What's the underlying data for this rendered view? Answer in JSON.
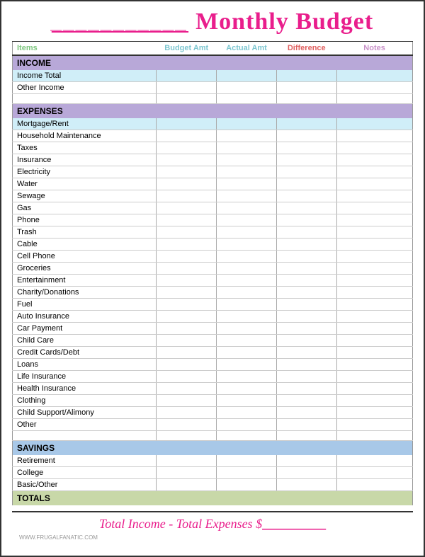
{
  "header": {
    "underline_text": "___________",
    "title": "Monthly Budget"
  },
  "columns": {
    "items": "Items",
    "budget": "Budget Amt",
    "actual": "Actual Amt",
    "difference": "Difference",
    "notes": "Notes"
  },
  "sections": {
    "income": {
      "label": "INCOME",
      "rows": [
        {
          "label": "Income Total"
        },
        {
          "label": "Other Income"
        },
        {
          "label": ""
        }
      ]
    },
    "expenses": {
      "label": "EXPENSES",
      "rows": [
        {
          "label": "Mortgage/Rent"
        },
        {
          "label": "Household Maintenance"
        },
        {
          "label": "Taxes"
        },
        {
          "label": "Insurance"
        },
        {
          "label": "Electricity"
        },
        {
          "label": "Water"
        },
        {
          "label": "Sewage"
        },
        {
          "label": "Gas"
        },
        {
          "label": "Phone"
        },
        {
          "label": "Trash"
        },
        {
          "label": "Cable"
        },
        {
          "label": "Cell Phone"
        },
        {
          "label": "Groceries"
        },
        {
          "label": "Entertainment"
        },
        {
          "label": "Charity/Donations"
        },
        {
          "label": "Fuel"
        },
        {
          "label": "Auto Insurance"
        },
        {
          "label": "Car Payment"
        },
        {
          "label": "Child Care"
        },
        {
          "label": "Credit Cards/Debt"
        },
        {
          "label": "Loans"
        },
        {
          "label": "Life Insurance"
        },
        {
          "label": "Health Insurance"
        },
        {
          "label": "Clothing"
        },
        {
          "label": "Child Support/Alimony"
        },
        {
          "label": "Other"
        },
        {
          "label": ""
        }
      ]
    },
    "savings": {
      "label": "SAVINGS",
      "rows": [
        {
          "label": "Retirement"
        },
        {
          "label": "College"
        },
        {
          "label": "Basic/Other"
        }
      ]
    },
    "totals": {
      "label": "TOTALS",
      "rows": []
    }
  },
  "footer": {
    "text": "Total Income - Total Expenses $",
    "underline": "__________",
    "website": "WWW.FRUGALFANATIC.COM"
  }
}
